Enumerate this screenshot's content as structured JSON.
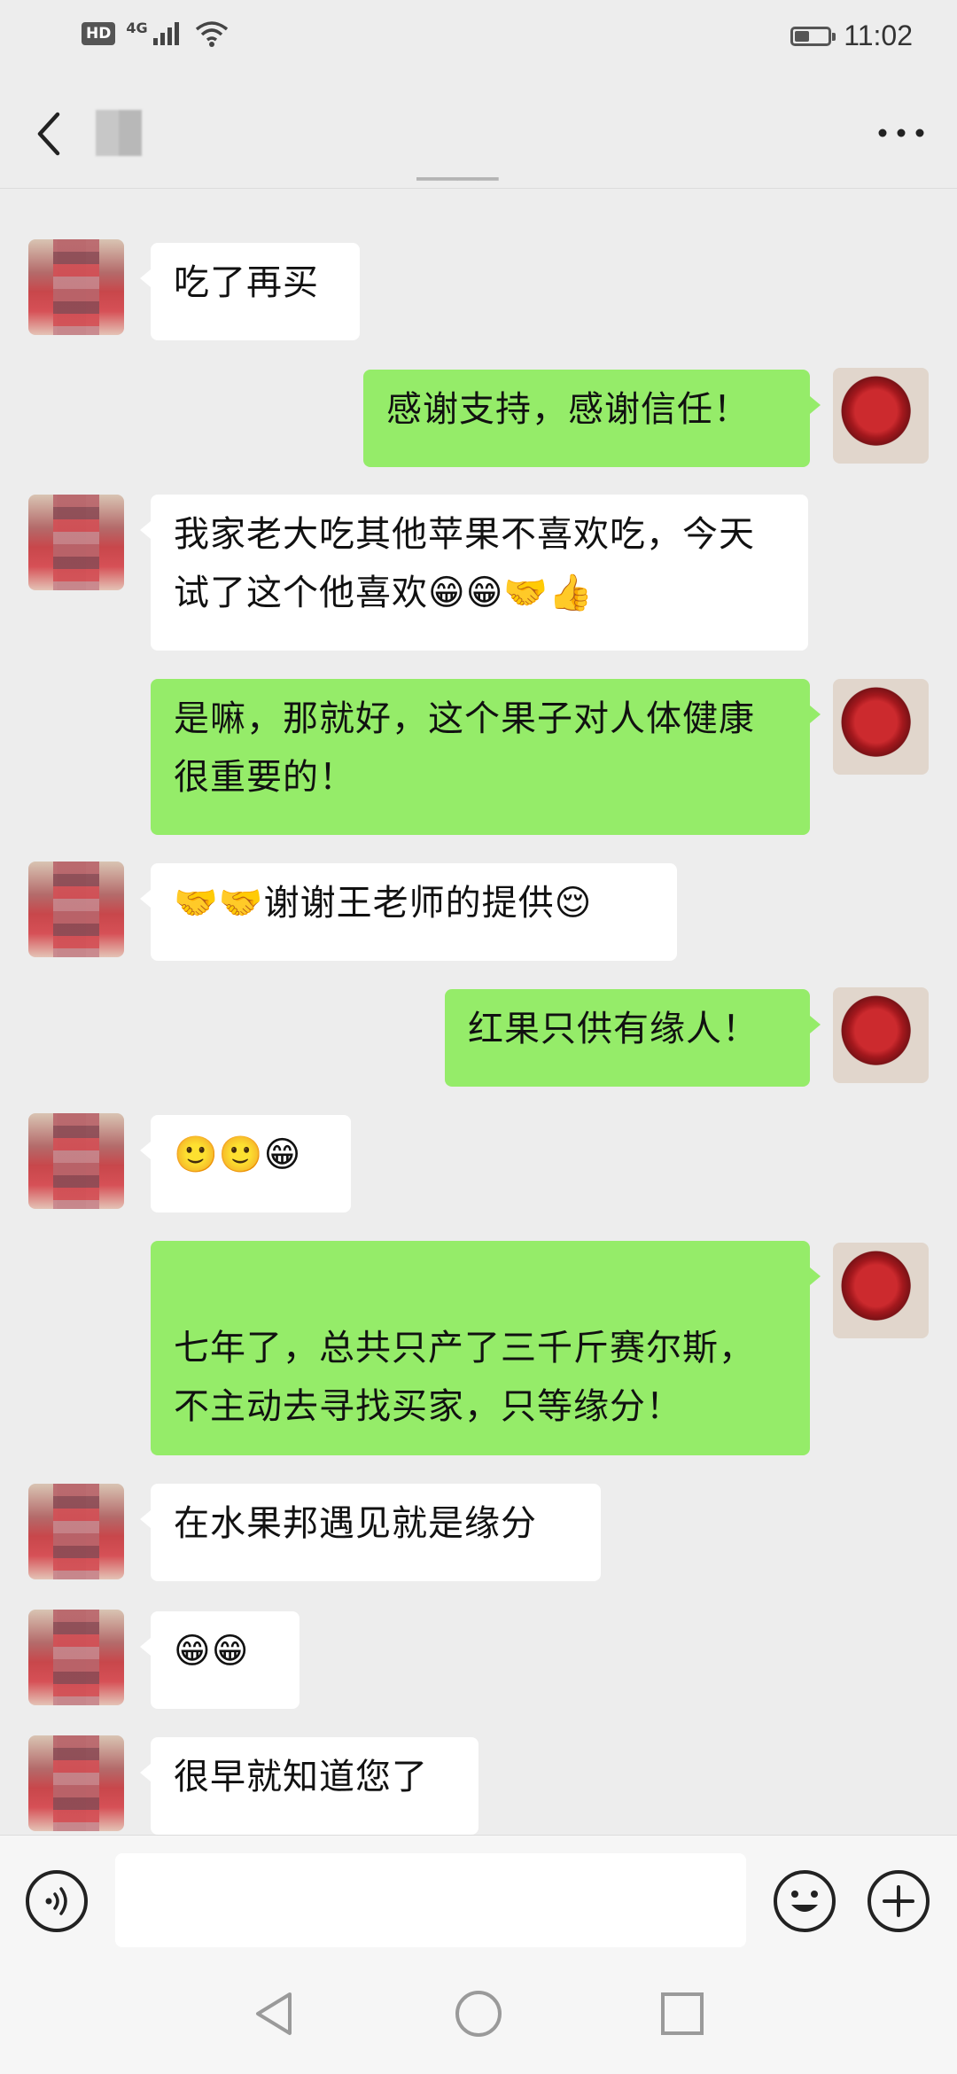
{
  "status_bar": {
    "hd_badge": "HD",
    "network": "4G",
    "time": "11:02",
    "battery_level": 0.45,
    "icons": [
      "signal-icon",
      "wifi-icon",
      "battery-icon"
    ]
  },
  "header": {
    "back_icon": "chevron-left-icon",
    "more_icon": "more-dots-icon"
  },
  "messages": [
    {
      "side": "in",
      "text": "吃了再买"
    },
    {
      "side": "out",
      "text": "感谢支持，感谢信任！"
    },
    {
      "side": "in",
      "text": "我家老大吃其他苹果不喜欢吃，今天试了这个他喜欢😁😁🤝👍"
    },
    {
      "side": "out",
      "text": "是嘛，那就好，这个果子对人体健康很重要的！"
    },
    {
      "side": "in",
      "text": "🤝🤝谢谢王老师的提供😌"
    },
    {
      "side": "out",
      "text": "红果只供有缘人！"
    },
    {
      "side": "in",
      "text": "🙂🙂😁"
    },
    {
      "side": "out",
      "text": "七年了，总共只产了三千斤赛尔斯，不主动去寻找买家，只等缘分！"
    },
    {
      "side": "in",
      "text": "在水果邦遇见就是缘分"
    },
    {
      "side": "in",
      "text": "😁😁"
    },
    {
      "side": "in",
      "text": "很早就知道您了"
    }
  ],
  "input_bar": {
    "voice_icon": "voice-icon",
    "emoji_icon": "emoji-icon",
    "plus_icon": "plus-icon",
    "text_value": ""
  },
  "system_nav": {
    "icons": [
      "back-triangle-icon",
      "home-circle-icon",
      "recents-square-icon"
    ]
  },
  "colors": {
    "background": "#ededed",
    "outgoing_bubble": "#95ec69",
    "incoming_bubble": "#ffffff"
  }
}
